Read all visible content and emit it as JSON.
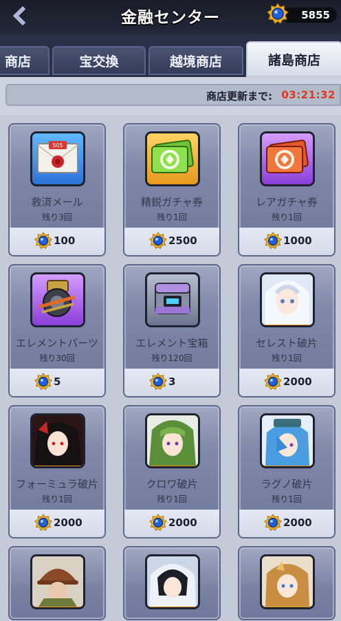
{
  "header": {
    "title": "金融センター",
    "currency_amount": "5855",
    "currency_icon": "blue-gem-medal-icon"
  },
  "tabs": [
    {
      "label": "商店",
      "active": false
    },
    {
      "label": "宝交換",
      "active": false
    },
    {
      "label": "越境商店",
      "active": false
    },
    {
      "label": "諸島商店",
      "active": true
    }
  ],
  "refresh": {
    "label": "商店更新まで:",
    "timer": "03:21:32"
  },
  "items": [
    {
      "name": "救済メール",
      "remaining": "残り3回",
      "price": "100",
      "icon": "sos-mail-icon",
      "frame": "blue"
    },
    {
      "name": "精鋭ガチャ券",
      "remaining": "残り1回",
      "price": "2500",
      "icon": "green-ticket-icon",
      "frame": "orange"
    },
    {
      "name": "レアガチャ券",
      "remaining": "残り1回",
      "price": "1000",
      "icon": "red-ticket-icon",
      "frame": "purple"
    },
    {
      "name": "エレメントパーツ",
      "remaining": "残り30回",
      "price": "5",
      "icon": "element-parts-icon",
      "frame": "purple"
    },
    {
      "name": "エレメント宝箱",
      "remaining": "残り120回",
      "price": "3",
      "icon": "element-chest-icon",
      "frame": "gray"
    },
    {
      "name": "セレスト破片",
      "remaining": "残り1回",
      "price": "2000",
      "icon": "celeste-portrait-icon",
      "frame": "orange"
    },
    {
      "name": "フォーミュラ破片",
      "remaining": "残り1回",
      "price": "2000",
      "icon": "formula-portrait-icon",
      "frame": "orange"
    },
    {
      "name": "クロワ破片",
      "remaining": "残り1回",
      "price": "2000",
      "icon": "kurowa-portrait-icon",
      "frame": "orange"
    },
    {
      "name": "ラグノ破片",
      "remaining": "残り1回",
      "price": "2000",
      "icon": "raguno-portrait-icon",
      "frame": "orange"
    }
  ],
  "partial_items": [
    {
      "icon": "helmet-soldier-portrait-icon",
      "frame": "orange"
    },
    {
      "icon": "hooded-girl-portrait-icon",
      "frame": "orange"
    },
    {
      "icon": "blonde-girl-portrait-icon",
      "frame": "orange"
    }
  ],
  "colors": {
    "timer": "#e0371f",
    "medal_gold": "#f0b020",
    "gem_blue": "#1f5fd8"
  }
}
